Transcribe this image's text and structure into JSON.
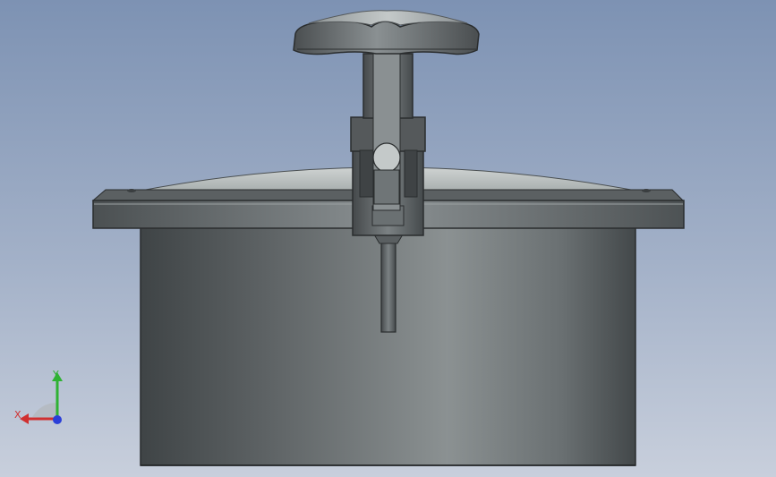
{
  "viewport": {
    "background_top": "#7d92b3",
    "background_bottom": "#c8cfdc"
  },
  "model": {
    "parts": [
      "handwheel-knob",
      "stem",
      "hinge-clamp",
      "dome-lid",
      "flange-rim",
      "swing-bolt",
      "cylinder-body"
    ],
    "body_color": "#6f7476",
    "lid_color": "#b9bfbf"
  },
  "triad": {
    "x_label": "X",
    "y_label": "Y",
    "x_color": "#d03030",
    "y_color": "#2fb233",
    "z_color": "#2b3fd8"
  }
}
